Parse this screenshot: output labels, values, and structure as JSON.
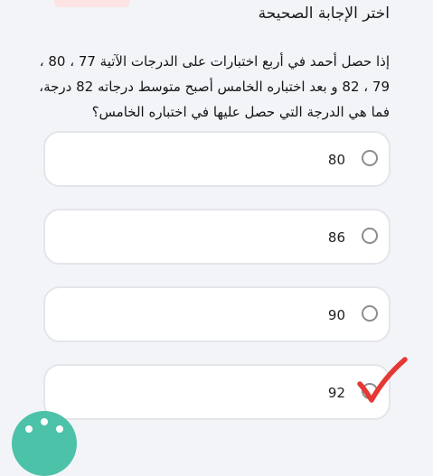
{
  "header": {
    "title": "اختر الإجابة الصحيحة"
  },
  "question": {
    "line1": "إذا حصل أحمد في أربع اختبارات على الدرجات الآتية  77 ، 80 ،",
    "line2": "79 ، 82  و بعد اختباره الخامس أصبح متوسط درجاته 82 درجة،",
    "line3": "فما هي الدرجة التي حصل عليها في اختباره الخامس؟"
  },
  "options": [
    {
      "label": "80"
    },
    {
      "label": "86"
    },
    {
      "label": "90"
    },
    {
      "label": "92"
    }
  ],
  "colors": {
    "accent": "#4cc2a8",
    "checkmark": "#e53935",
    "card_border": "#e3e5ea",
    "background": "#f3f4f8"
  },
  "icons": {
    "selection_mark": "check-mark-icon",
    "fab": "help-button-icon"
  }
}
